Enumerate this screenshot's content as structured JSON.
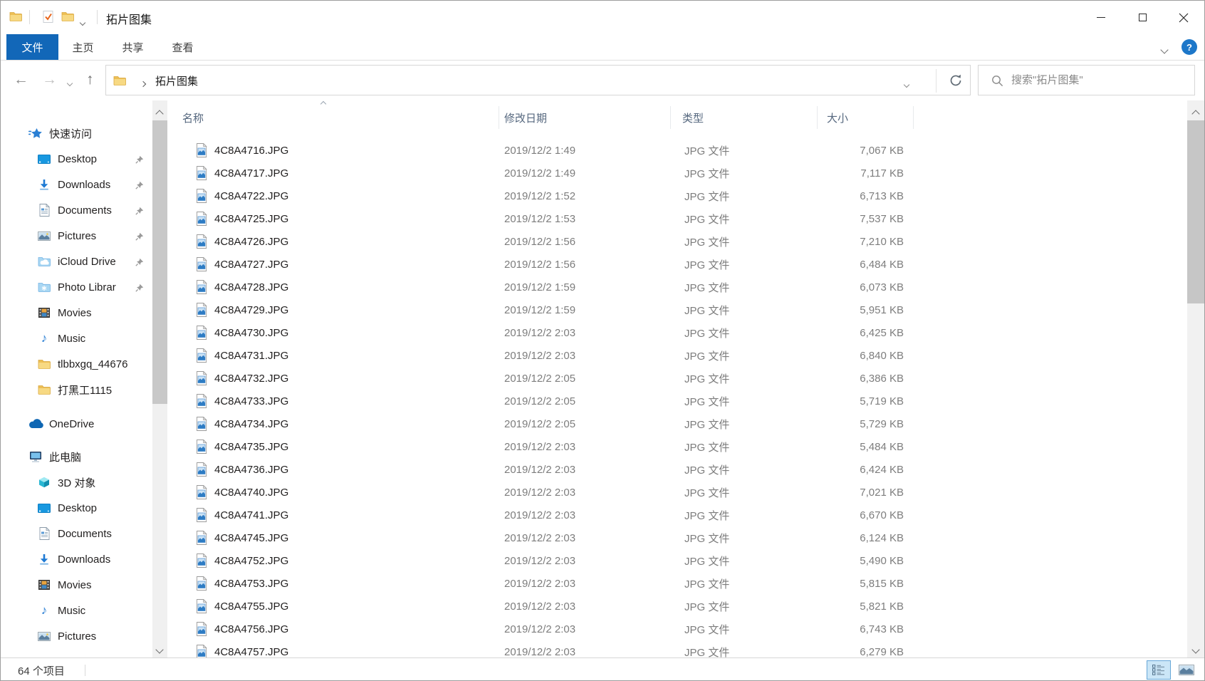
{
  "window": {
    "title": "拓片图集"
  },
  "quick_access_toolbar": {
    "icons": [
      "properties-check",
      "folder"
    ]
  },
  "ribbon": {
    "tabs": [
      {
        "label": "文件",
        "active": true
      },
      {
        "label": "主页",
        "active": false
      },
      {
        "label": "共享",
        "active": false
      },
      {
        "label": "查看",
        "active": false
      }
    ],
    "help_label": "?"
  },
  "navigation": {
    "breadcrumb": {
      "folder": "拓片图集"
    },
    "search_placeholder": "搜索\"拓片图集\""
  },
  "sidebar": {
    "sections": [
      {
        "header": {
          "label": "快速访问",
          "icon": "quick-access"
        },
        "items": [
          {
            "label": "Desktop",
            "icon": "desktop",
            "pinned": true
          },
          {
            "label": "Downloads",
            "icon": "downloads",
            "pinned": true
          },
          {
            "label": "Documents",
            "icon": "document",
            "pinned": true
          },
          {
            "label": "Pictures",
            "icon": "pictures",
            "pinned": true
          },
          {
            "label": "iCloud Drive",
            "icon": "icloud",
            "pinned": true
          },
          {
            "label": "Photo Librar",
            "icon": "photo-library",
            "pinned": true
          },
          {
            "label": "Movies",
            "icon": "movies",
            "pinned": false
          },
          {
            "label": "Music",
            "icon": "music",
            "pinned": false
          },
          {
            "label": "tlbbxgq_44676",
            "icon": "folder",
            "pinned": false
          },
          {
            "label": "打黑工1115",
            "icon": "folder",
            "pinned": false
          }
        ]
      },
      {
        "header": {
          "label": "OneDrive",
          "icon": "onedrive"
        },
        "items": []
      },
      {
        "header": {
          "label": "此电脑",
          "icon": "this-pc"
        },
        "items": [
          {
            "label": "3D 对象",
            "icon": "3d-objects",
            "pinned": false
          },
          {
            "label": "Desktop",
            "icon": "desktop",
            "pinned": false
          },
          {
            "label": "Documents",
            "icon": "document",
            "pinned": false
          },
          {
            "label": "Downloads",
            "icon": "downloads",
            "pinned": false
          },
          {
            "label": "Movies",
            "icon": "movies",
            "pinned": false
          },
          {
            "label": "Music",
            "icon": "music",
            "pinned": false
          },
          {
            "label": "Pictures",
            "icon": "pictures",
            "pinned": false
          }
        ]
      }
    ]
  },
  "file_list": {
    "columns": [
      {
        "label": "名称",
        "sort": "asc"
      },
      {
        "label": "修改日期",
        "sort": null
      },
      {
        "label": "类型",
        "sort": null
      },
      {
        "label": "大小",
        "sort": null
      }
    ],
    "rows": [
      {
        "name": "4C8A4716.JPG",
        "modified": "2019/12/2 1:49",
        "type": "JPG 文件",
        "size": "7,067 KB"
      },
      {
        "name": "4C8A4717.JPG",
        "modified": "2019/12/2 1:49",
        "type": "JPG 文件",
        "size": "7,117 KB"
      },
      {
        "name": "4C8A4722.JPG",
        "modified": "2019/12/2 1:52",
        "type": "JPG 文件",
        "size": "6,713 KB"
      },
      {
        "name": "4C8A4725.JPG",
        "modified": "2019/12/2 1:53",
        "type": "JPG 文件",
        "size": "7,537 KB"
      },
      {
        "name": "4C8A4726.JPG",
        "modified": "2019/12/2 1:56",
        "type": "JPG 文件",
        "size": "7,210 KB"
      },
      {
        "name": "4C8A4727.JPG",
        "modified": "2019/12/2 1:56",
        "type": "JPG 文件",
        "size": "6,484 KB"
      },
      {
        "name": "4C8A4728.JPG",
        "modified": "2019/12/2 1:59",
        "type": "JPG 文件",
        "size": "6,073 KB"
      },
      {
        "name": "4C8A4729.JPG",
        "modified": "2019/12/2 1:59",
        "type": "JPG 文件",
        "size": "5,951 KB"
      },
      {
        "name": "4C8A4730.JPG",
        "modified": "2019/12/2 2:03",
        "type": "JPG 文件",
        "size": "6,425 KB"
      },
      {
        "name": "4C8A4731.JPG",
        "modified": "2019/12/2 2:03",
        "type": "JPG 文件",
        "size": "6,840 KB"
      },
      {
        "name": "4C8A4732.JPG",
        "modified": "2019/12/2 2:05",
        "type": "JPG 文件",
        "size": "6,386 KB"
      },
      {
        "name": "4C8A4733.JPG",
        "modified": "2019/12/2 2:05",
        "type": "JPG 文件",
        "size": "5,719 KB"
      },
      {
        "name": "4C8A4734.JPG",
        "modified": "2019/12/2 2:05",
        "type": "JPG 文件",
        "size": "5,729 KB"
      },
      {
        "name": "4C8A4735.JPG",
        "modified": "2019/12/2 2:03",
        "type": "JPG 文件",
        "size": "5,484 KB"
      },
      {
        "name": "4C8A4736.JPG",
        "modified": "2019/12/2 2:03",
        "type": "JPG 文件",
        "size": "6,424 KB"
      },
      {
        "name": "4C8A4740.JPG",
        "modified": "2019/12/2 2:03",
        "type": "JPG 文件",
        "size": "7,021 KB"
      },
      {
        "name": "4C8A4741.JPG",
        "modified": "2019/12/2 2:03",
        "type": "JPG 文件",
        "size": "6,670 KB"
      },
      {
        "name": "4C8A4745.JPG",
        "modified": "2019/12/2 2:03",
        "type": "JPG 文件",
        "size": "6,124 KB"
      },
      {
        "name": "4C8A4752.JPG",
        "modified": "2019/12/2 2:03",
        "type": "JPG 文件",
        "size": "5,490 KB"
      },
      {
        "name": "4C8A4753.JPG",
        "modified": "2019/12/2 2:03",
        "type": "JPG 文件",
        "size": "5,815 KB"
      },
      {
        "name": "4C8A4755.JPG",
        "modified": "2019/12/2 2:03",
        "type": "JPG 文件",
        "size": "5,821 KB"
      },
      {
        "name": "4C8A4756.JPG",
        "modified": "2019/12/2 2:03",
        "type": "JPG 文件",
        "size": "6,743 KB"
      },
      {
        "name": "4C8A4757.JPG",
        "modified": "2019/12/2 2:03",
        "type": "JPG 文件",
        "size": "6,279 KB"
      }
    ]
  },
  "status_bar": {
    "item_count": "64 个项目",
    "active_view": "details"
  },
  "colors": {
    "file_tab_blue": "#1267b8",
    "help_badge_blue": "#1d77c9",
    "folder_yellow": "#f0c255",
    "row_text": "#211f1f",
    "meta_text": "#7d7d7d",
    "header_text": "#55677e"
  }
}
